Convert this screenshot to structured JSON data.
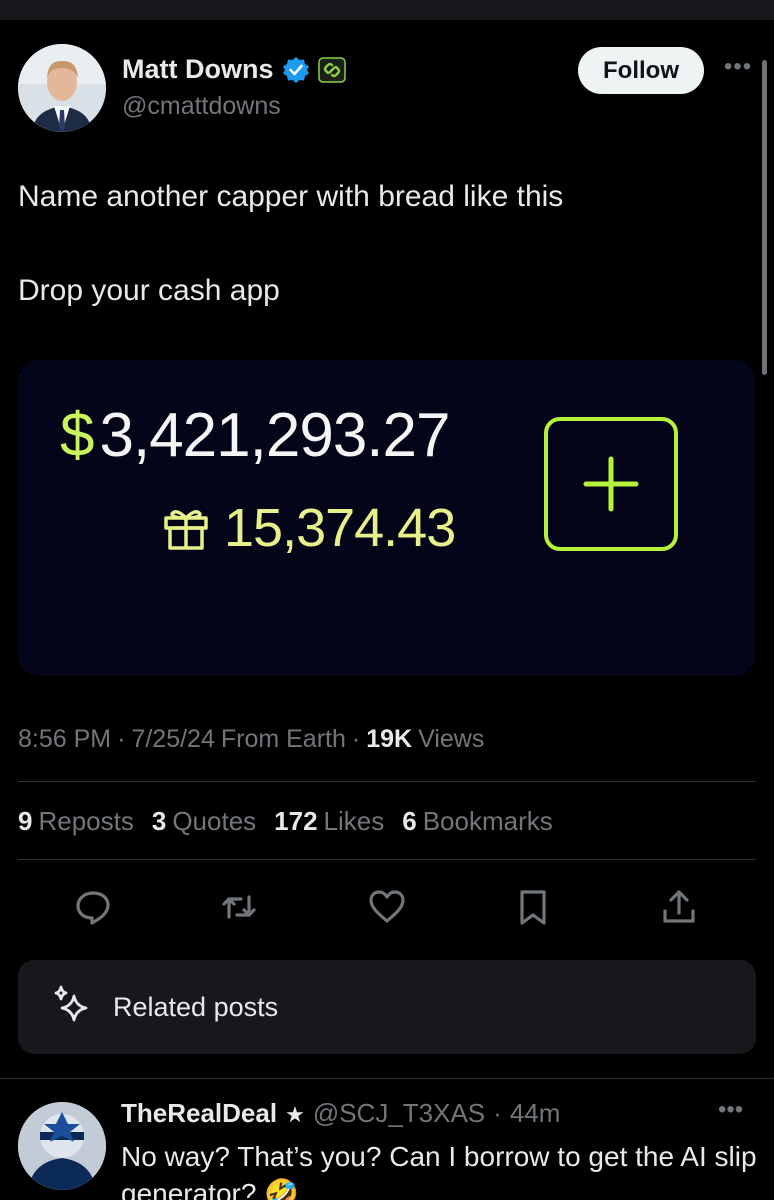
{
  "author": {
    "name": "Matt Downs",
    "handle": "@cmattdowns",
    "follow_label": "Follow",
    "more_label": "•••"
  },
  "tweet": {
    "line1": "Name another capper with bread like this",
    "line2": "Drop your cash app"
  },
  "media": {
    "currency_symbol": "$",
    "balance": "3,421,293.27",
    "gift_balance": "15,374.43",
    "accent": "#b5f23a"
  },
  "meta": {
    "time": "8:56 PM",
    "sep1": "·",
    "date": "7/25/24",
    "source": "From Earth",
    "sep2": "·",
    "views_count": "19K",
    "views_label": "Views"
  },
  "stats": [
    {
      "num": "9",
      "label": "Reposts"
    },
    {
      "num": "3",
      "label": "Quotes"
    },
    {
      "num": "172",
      "label": "Likes"
    },
    {
      "num": "6",
      "label": "Bookmarks"
    }
  ],
  "actions": [
    "reply-icon",
    "repost-icon",
    "like-icon",
    "bookmark-icon",
    "share-icon"
  ],
  "related": {
    "label": "Related posts"
  },
  "reply": {
    "name": "TheRealDeal",
    "star": "★",
    "handle": "@SCJ_T3XAS",
    "sep": "·",
    "time": "44m",
    "more_label": "•••",
    "text": "No way? That’s you? Can I borrow to get the AI slip generator? 🤣"
  }
}
